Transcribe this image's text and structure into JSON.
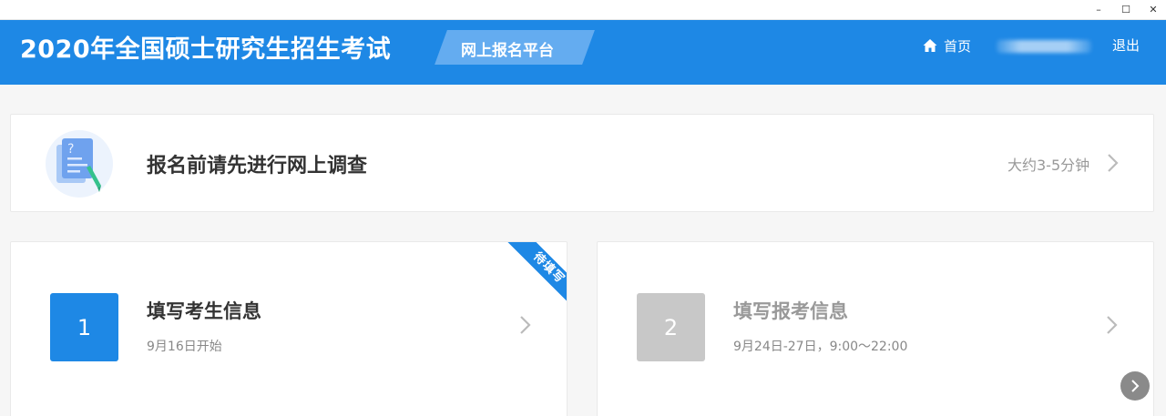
{
  "window": {
    "minimize": "–",
    "maximize": "☐",
    "close": "✕"
  },
  "header": {
    "title": "2020年全国硕士研究生招生考试",
    "platform": "网上报名平台",
    "home": "首页",
    "logout": "退出"
  },
  "survey": {
    "title": "报名前请先进行网上调查",
    "duration": "大约3-5分钟"
  },
  "steps": [
    {
      "number": "1",
      "title": "填写考生信息",
      "subtitle": "9月16日开始",
      "ribbon": "待填写",
      "color": "#1e88e5",
      "title_color": "#333333"
    },
    {
      "number": "2",
      "title": "填写报考信息",
      "subtitle": "9月24日-27日，9:00～22:00",
      "color": "#c8c8c8",
      "title_color": "#999999"
    }
  ],
  "icons": {
    "home": "home-icon",
    "survey": "survey-document-icon",
    "chevron": "chevron-right-icon",
    "scroll": "chevron-right-icon"
  },
  "colors": {
    "brand": "#1e88e5",
    "page_bg": "#f6f6f6"
  }
}
